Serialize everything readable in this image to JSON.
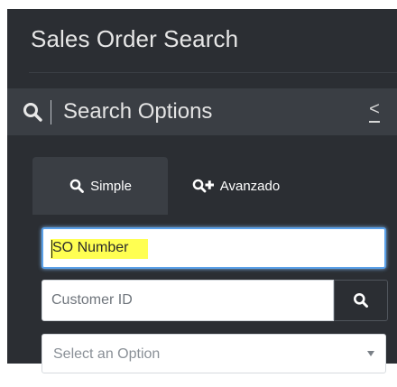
{
  "page": {
    "title": "Sales Order Search"
  },
  "search_panel": {
    "title": "Search Options",
    "header_icon": "search-icon",
    "collapse_icon": "chevron-left-icon",
    "collapse_glyph": "<"
  },
  "tabs": [
    {
      "label": "Simple",
      "icon": "search-icon",
      "active": true
    },
    {
      "label": "Avanzado",
      "icon": "search-plus-icon",
      "active": false
    }
  ],
  "fields": {
    "so_number": {
      "placeholder": "SO Number",
      "value": ""
    },
    "customer_id": {
      "placeholder": "Customer ID",
      "value": ""
    },
    "option_select": {
      "selected_text": "Select an Option"
    }
  },
  "colors": {
    "background": "#2b2e33",
    "header_bar": "#3a3e44",
    "focus_border": "#5aa0e8",
    "highlight": "#ffff52"
  }
}
